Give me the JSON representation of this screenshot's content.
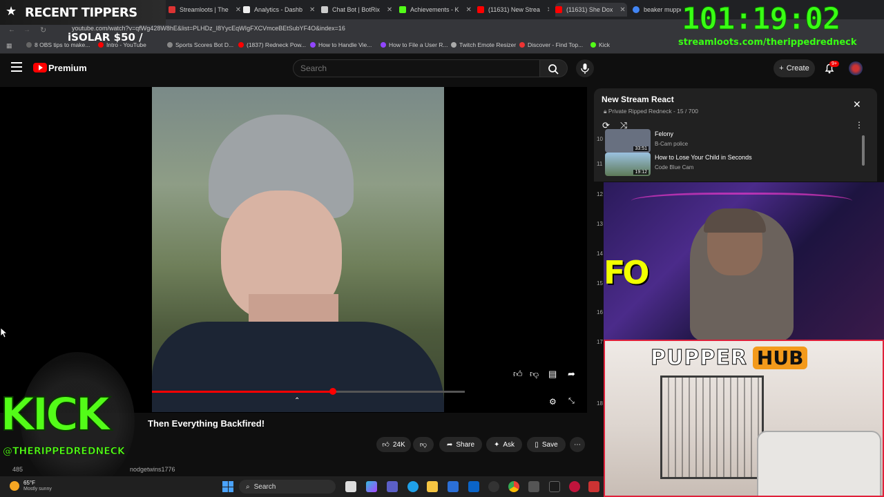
{
  "browser": {
    "tabs": [
      {
        "label": "Streamloots | The"
      },
      {
        "label": "Analytics - Dashb"
      },
      {
        "label": "Chat Bot | BotRix"
      },
      {
        "label": "Achievements - K"
      },
      {
        "label": "(11631) New Strea"
      },
      {
        "label": "(11631) She Dox"
      },
      {
        "label": "beaker muppets"
      }
    ],
    "url": "youtube.com/watch?v=qfWg428W8hE&list=PLHDz_I8YycEqWIgFXCVmceBEtSubYF4O&index=16",
    "bookmarks": [
      {
        "label": "8 OBS tips to make..."
      },
      {
        "label": "Intro - YouTube"
      },
      {
        "label": "Sports Scores Bot D..."
      },
      {
        "label": "(1837) Redneck Pow..."
      },
      {
        "label": "How to Handle Vie..."
      },
      {
        "label": "How to File a User R..."
      },
      {
        "label": "Twitch Emote Resizer"
      },
      {
        "label": "Discover - Find Top..."
      },
      {
        "label": "Kick"
      }
    ]
  },
  "youtube": {
    "logo_label": "Premium",
    "search_placeholder": "Search",
    "create_label": "Create",
    "notifications": "9+",
    "video_title": "Then Everything Backfired!",
    "actions": {
      "likes": "24K",
      "share": "Share",
      "ask": "Ask",
      "save": "Save"
    },
    "channel_handle": "nodgetwins1776",
    "subscriber_fragment": "485"
  },
  "playlist": {
    "title": "New Stream React",
    "privacy": "Private",
    "owner": "Ripped Redneck",
    "position": "15 / 700",
    "items": [
      {
        "index": "10",
        "title": "Felony",
        "channel": "B-Cam police",
        "duration": "33:51"
      },
      {
        "index": "11",
        "title": "How to Lose Your Child in Seconds",
        "channel": "Code Blue Cam",
        "duration": "19:12"
      }
    ],
    "hidden_indexes": [
      "12",
      "13",
      "14",
      "15",
      "16",
      "17",
      "18"
    ]
  },
  "overlays": {
    "tippers_label": "RECENT TIPPERS",
    "tipper_entry": "iSOLAR $50 /",
    "timer": "101:19:02",
    "streamloots_url": "streamloots.com/therippedredneck",
    "kick_text": "KICK",
    "kick_handle": "@THERIPPEDREDNECK",
    "pupper_word": "PUPPER",
    "hub_word": "HUB",
    "webcam_logo": "FO"
  },
  "taskbar": {
    "temperature": "65°F",
    "weather": "Mostly sunny",
    "search_label": "Search"
  },
  "colors": {
    "timer_green": "#39ff14",
    "kick_green": "#53fc18",
    "youtube_red": "#ff0000",
    "hub_orange": "#f39a1b"
  }
}
